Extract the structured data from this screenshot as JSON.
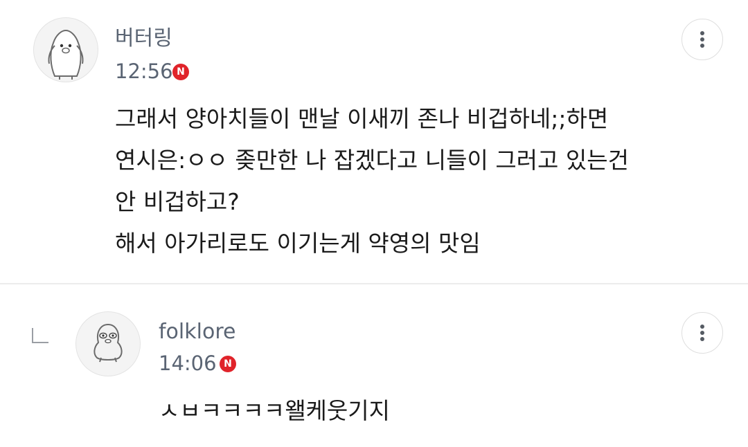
{
  "comments": [
    {
      "author": "버터링",
      "time": "12:56",
      "badge": "N",
      "avatar_icon": "penguin-character-icon",
      "lines": [
        "그래서 양아치들이 맨날 이새끼 존나 비겁하네;;하면",
        "연시은:ㅇㅇ 좆만한 나 잡겠다고 니들이 그러고 있는건",
        "안 비겁하고?",
        "해서 아가리로도 이기는게 약영의 맛임"
      ]
    },
    {
      "author": "folklore",
      "time": "14:06",
      "badge": "N",
      "avatar_icon": "chick-character-icon",
      "reply_icon": "reply-arrow-icon",
      "lines": [
        "ㅅㅂㅋㅋㅋㅋ왤케웃기지"
      ]
    }
  ],
  "colors": {
    "badge": "#e0232a",
    "meta_text": "#5a6473",
    "body_text": "#1a1a1a"
  }
}
